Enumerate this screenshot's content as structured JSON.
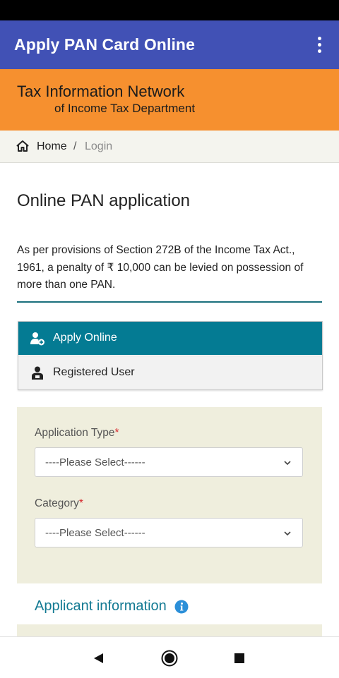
{
  "app_bar": {
    "title": "Apply PAN Card Online",
    "menu_icon": "more-vert-icon",
    "color": "#4151b5"
  },
  "banner": {
    "line1": "Tax Information Network",
    "line2": "of Income Tax Department",
    "color": "#f6902f"
  },
  "breadcrumb": {
    "home_icon": "home-icon",
    "home": "Home",
    "separator": "/",
    "current": "Login"
  },
  "main": {
    "title": "Online PAN application",
    "notice": "As per provisions of Section 272B of the Income Tax Act., 1961, a penalty of ₹ 10,000 can be levied on possession of more than one PAN."
  },
  "tabs": [
    {
      "label": "Apply Online",
      "icon": "add-user-icon",
      "active": true
    },
    {
      "label": "Registered User",
      "icon": "registered-user-icon",
      "active": false
    }
  ],
  "form": {
    "application_type": {
      "label": "Application Type",
      "required_mark": "*",
      "value": "----Please Select------"
    },
    "category": {
      "label": "Category",
      "required_mark": "*",
      "value": "----Please Select------"
    }
  },
  "section": {
    "title": "Applicant information",
    "icon": "info-icon"
  },
  "nav_bar": {
    "buttons": [
      "back-icon",
      "home-circle-icon",
      "recents-icon"
    ]
  },
  "colors": {
    "accent_teal": "#047b93",
    "section_title": "#137a93",
    "panel_bg": "#efeedd",
    "required": "#d6262b"
  }
}
